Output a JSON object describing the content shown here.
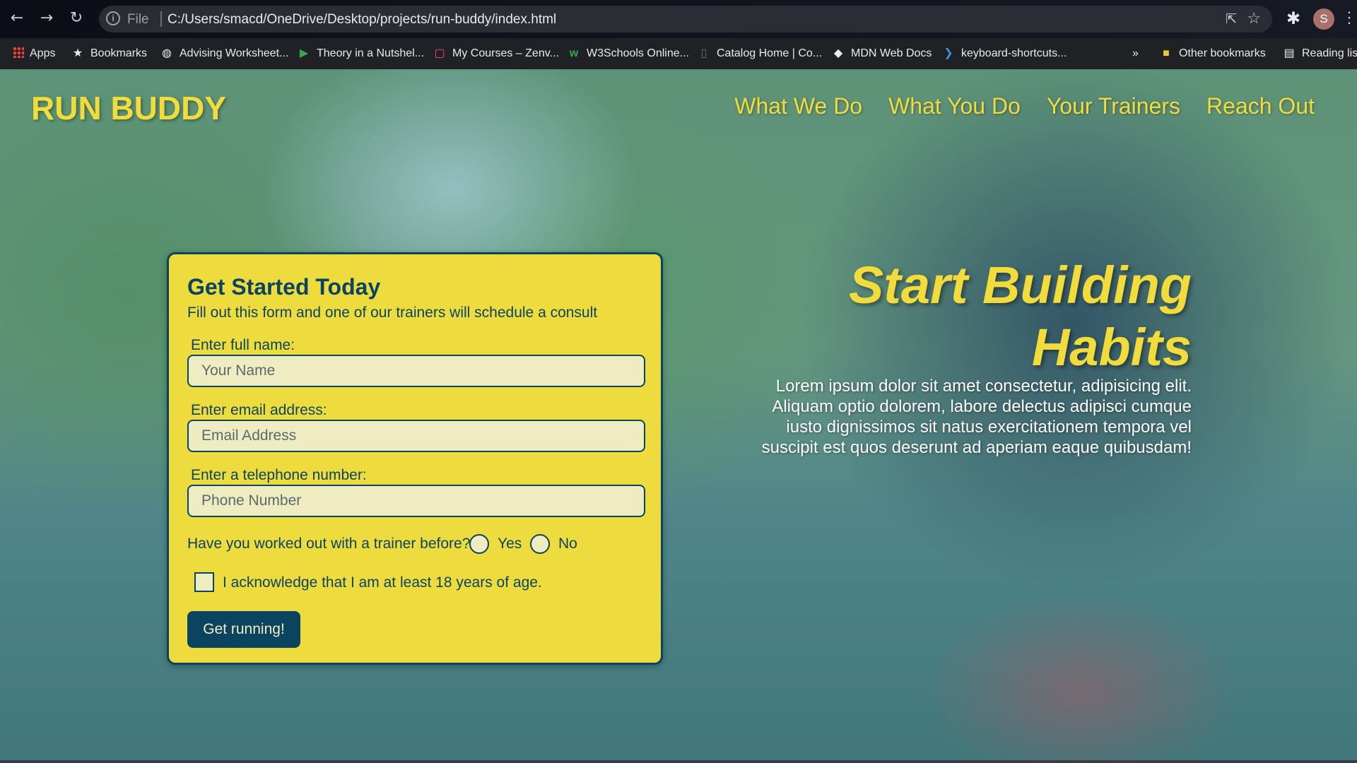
{
  "browser": {
    "file_label": "File",
    "url": "C:/Users/smacd/OneDrive/Desktop/projects/run-buddy/index.html",
    "avatar_initial": "S",
    "bookmarks": [
      {
        "label": "Apps",
        "icon": "apps-grid-icon"
      },
      {
        "label": "Bookmarks",
        "icon": "star-icon"
      },
      {
        "label": "Advising Worksheet...",
        "icon": "globe-icon"
      },
      {
        "label": "Theory in a Nutshel...",
        "icon": "play-icon"
      },
      {
        "label": "My Courses – Zenv...",
        "icon": "square-icon"
      },
      {
        "label": "W3Schools Online...",
        "icon": "w3-icon"
      },
      {
        "label": "Catalog Home | Co...",
        "icon": "catalog-icon"
      },
      {
        "label": "MDN Web Docs",
        "icon": "mdn-icon"
      },
      {
        "label": "keyboard-shortcuts...",
        "icon": "vscode-icon"
      }
    ],
    "overflow": "»",
    "other_bookmarks": "Other bookmarks",
    "reading_list": "Reading list"
  },
  "header": {
    "logo": "RUN BUDDY",
    "nav": [
      "What We Do",
      "What You Do",
      "Your Trainers",
      "Reach Out"
    ]
  },
  "form": {
    "title": "Get Started Today",
    "subtitle": "Fill out this form and one of our trainers will schedule a consult",
    "name_label": "Enter full name:",
    "name_placeholder": "Your Name",
    "email_label": "Enter email address:",
    "email_placeholder": "Email Address",
    "phone_label": "Enter a telephone number:",
    "phone_placeholder": "Phone Number",
    "trainer_question": "Have you worked out with a trainer before?",
    "yes_label": "Yes",
    "no_label": "No",
    "age_ack": "I acknowledge that I am at least 18 years of age.",
    "submit_label": "Get running!"
  },
  "hero": {
    "title_line1": "Start Building",
    "title_line2": "Habits",
    "text": "Lorem ipsum dolor sit amet consectetur, adipisicing elit. Aliquam optio dolorem, labore delectus adipisci cumque iusto dignissimos sit natus exercitationem tempora vel suscipit est quos deserunt ad aperiam eaque quibusdam!"
  },
  "colors": {
    "accent_yellow": "#f1dc3b",
    "navy": "#0b4461",
    "form_bg": "#eedc3e"
  }
}
